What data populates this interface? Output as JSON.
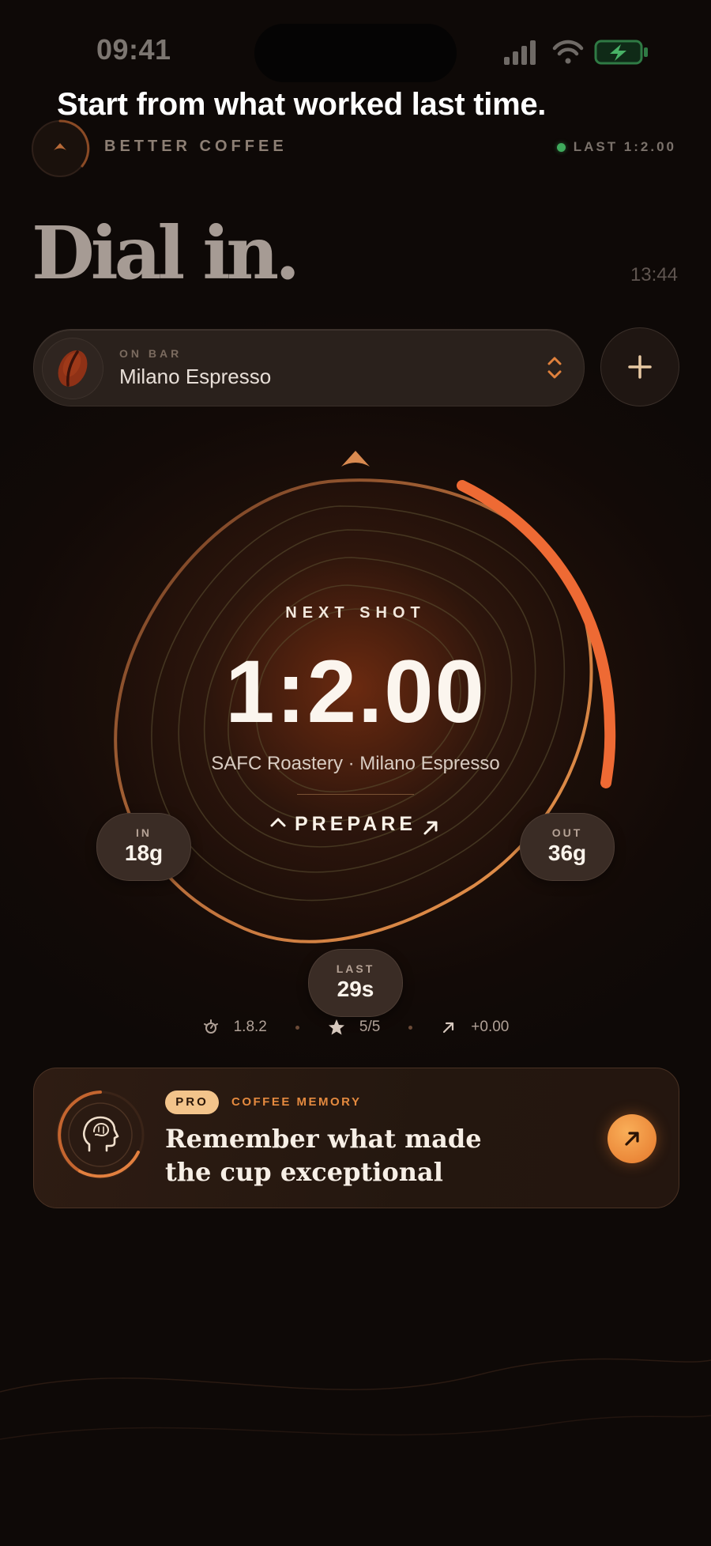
{
  "status_bar": {
    "time": "09:41",
    "icons": [
      "signal-icon",
      "wifi-icon",
      "battery-charging-icon"
    ]
  },
  "caption": "Start from what worked last time.",
  "header": {
    "brand": "BETTER COFFEE",
    "last_label": "LAST 1:2.00",
    "status_color": "#3faa5c"
  },
  "title": "Dial in.",
  "clock": "13:44",
  "bean_selector": {
    "label": "ON BAR",
    "bean": "Milano Espresso"
  },
  "add_button": {
    "icon": "plus-icon"
  },
  "dial": {
    "next_label": "NEXT SHOT",
    "ratio": "1:2.00",
    "origin": "SAFC Roastery · Milano Espresso",
    "prepare": "PREPARE",
    "progress": 0.28,
    "in": {
      "label": "IN",
      "value": "18g"
    },
    "out": {
      "label": "OUT",
      "value": "36g"
    },
    "last": {
      "label": "LAST",
      "value": "29s"
    }
  },
  "stats": {
    "grind": "1.8.2",
    "rating": "5/5",
    "delta": "+0.00"
  },
  "pro_card": {
    "badge": "PRO",
    "label": "COFFEE MEMORY",
    "title": "Remember what made the cup exceptional"
  },
  "colors": {
    "accent": "#ea6a34",
    "accent_light": "#f3c48b",
    "background": "#120a07"
  }
}
